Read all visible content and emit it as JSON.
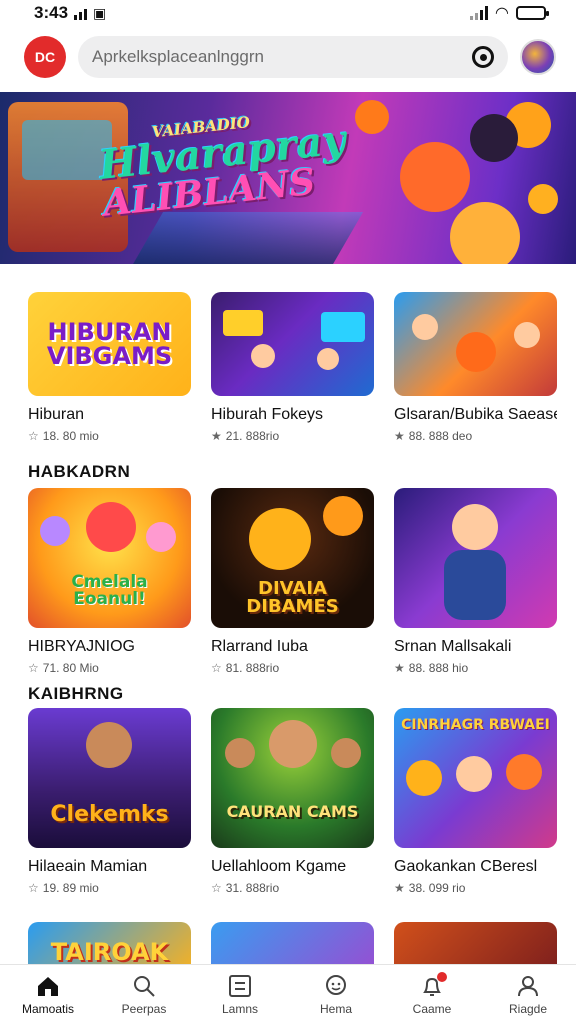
{
  "status_bar": {
    "time": "3:43"
  },
  "header": {
    "logo_text": "DC",
    "search_placeholder": "Aprkelksplaceanlnggrn"
  },
  "banner": {
    "title_line1": "VAIABADIO",
    "title_line2": "Hlvarapray",
    "title_line3": "ALIBLANS"
  },
  "sections": [
    {
      "title": "",
      "cards": [
        {
          "title": "Hiburan",
          "meta": "18. 80 mio",
          "thumb_text": "HIBURAN VIBGAMS"
        },
        {
          "title": "Hiburah Fokeys",
          "meta": "21. 888rio",
          "thumb_text": ""
        },
        {
          "title": "Glsaran/Bubika Saease",
          "meta": "88. 888 deo",
          "thumb_text": ""
        }
      ]
    },
    {
      "title": "HABKADRN",
      "cards": [
        {
          "title": "HIBRYAJNIOG",
          "meta": "71. 80 Mio",
          "thumb_text": "Cmelala Eoanul!"
        },
        {
          "title": "Rlarrand Iuba",
          "meta": "81. 888rio",
          "thumb_text": "DIVAIA DIBAMES"
        },
        {
          "title": "Srnan Mallsakali",
          "meta": "88. 888 hio",
          "thumb_text": ""
        }
      ]
    },
    {
      "title": "KAIBHRNG",
      "cards": [
        {
          "title": "Hilaeain Mamian",
          "meta": "19. 89 mio",
          "thumb_text": "Clekemks"
        },
        {
          "title": "Uellahloom Kgame",
          "meta": "31. 888rio",
          "thumb_text": "CAURAN CAMS"
        },
        {
          "title": "Gaokankan CBeresl",
          "meta": "38. 099 rio",
          "thumb_text": "CINRHAGR RBWAEI"
        }
      ]
    },
    {
      "title": "",
      "cards": [
        {
          "title": "",
          "meta": "",
          "thumb_text": "TAIROAK"
        },
        {
          "title": "",
          "meta": "",
          "thumb_text": ""
        },
        {
          "title": "",
          "meta": "",
          "thumb_text": ""
        }
      ]
    }
  ],
  "bottom_nav": [
    {
      "label": "Mamoatis",
      "icon": "home-icon"
    },
    {
      "label": "Peerpas",
      "icon": "search-icon"
    },
    {
      "label": "Lamns",
      "icon": "list-icon"
    },
    {
      "label": "Hema",
      "icon": "chat-icon"
    },
    {
      "label": "Caame",
      "icon": "bell-icon"
    },
    {
      "label": "Riagde",
      "icon": "person-icon"
    }
  ]
}
